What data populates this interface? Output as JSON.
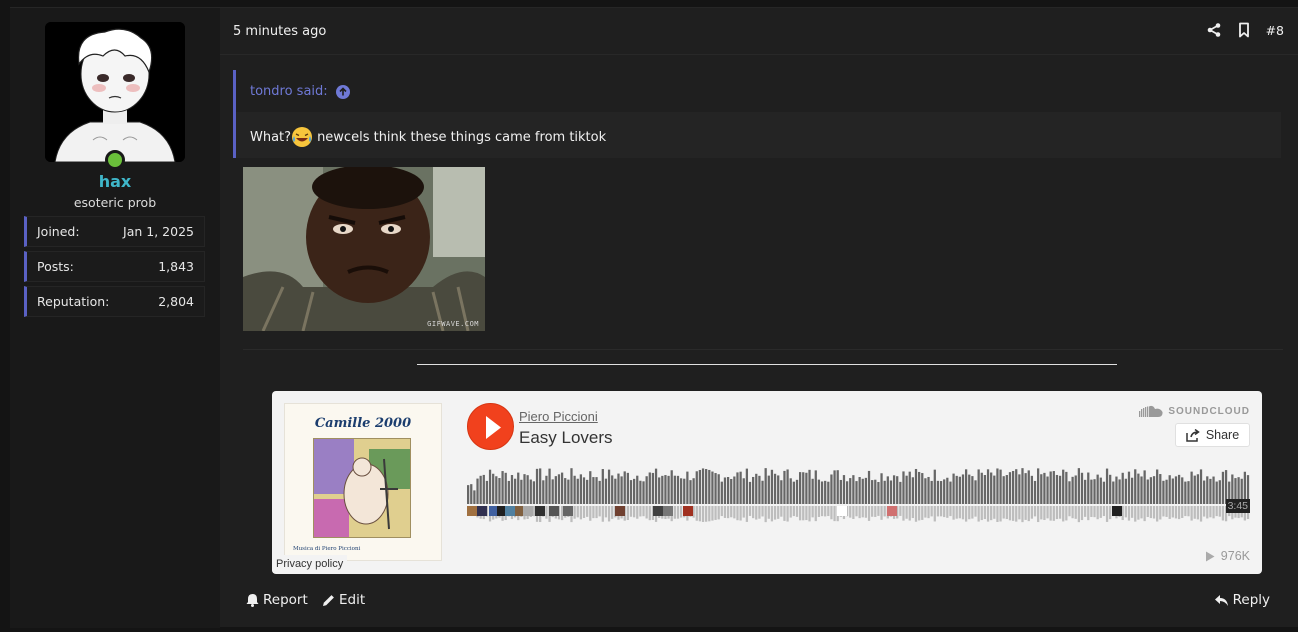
{
  "user": {
    "name": "hax",
    "title": "esoteric prob",
    "stats": [
      {
        "label": "Joined:",
        "value": "Jan 1, 2025"
      },
      {
        "label": "Posts:",
        "value": "1,843"
      },
      {
        "label": "Reputation:",
        "value": "2,804"
      }
    ],
    "online": true
  },
  "post": {
    "time": "5 minutes ago",
    "number": "#8",
    "quote": {
      "author": "tondro said:",
      "text_before": "What?",
      "emoji": "laughing-crying-emoji",
      "text_after": " newcels think these things came from tiktok"
    },
    "gif_caption": "GIFWAVE.COM"
  },
  "soundcloud": {
    "art_title": "Camille 2000",
    "art_credit": "Musica di Piero Piccioni",
    "artist": "Piero Piccioni",
    "track": "Easy Lovers",
    "brand": "SOUNDCLOUD",
    "share_label": "Share",
    "duration": "3:45",
    "plays": "976K",
    "privacy": "Privacy policy",
    "accent": "#f1411d"
  },
  "footer": {
    "report": "Report",
    "edit": "Edit",
    "reply": "Reply"
  },
  "colors": {
    "username": "#3fb6c9",
    "quote_accent": "#5a61c4",
    "online": "#6abf3a"
  }
}
